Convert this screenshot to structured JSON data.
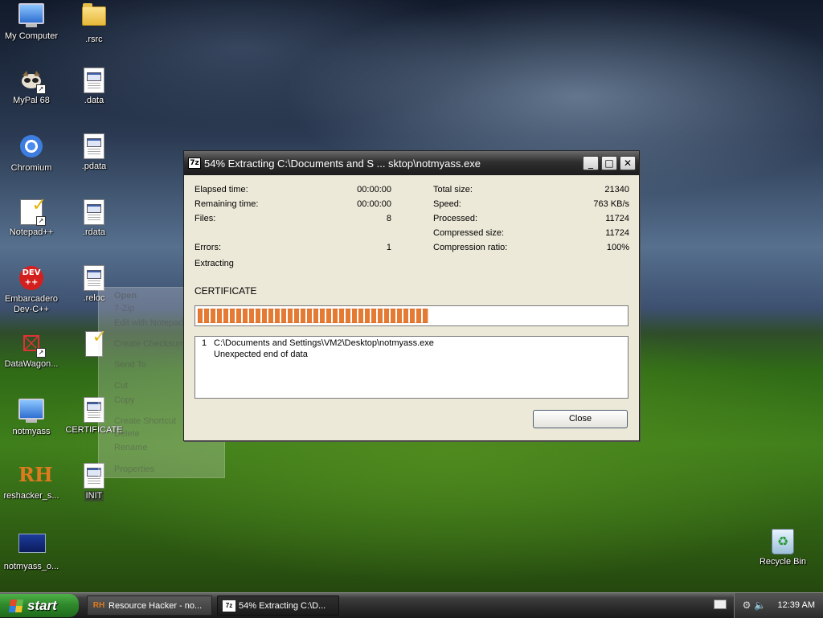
{
  "desktop": {
    "icons": [
      {
        "label": "My Computer"
      },
      {
        "label": ".rsrc"
      },
      {
        "label": "MyPal 68"
      },
      {
        "label": ".data"
      },
      {
        "label": "Chromium"
      },
      {
        "label": ".pdata"
      },
      {
        "label": "Notepad++"
      },
      {
        "label": ".rdata"
      },
      {
        "label": "Embarcadero Dev-C++"
      },
      {
        "label": ".reloc"
      },
      {
        "label": "DataWagon..."
      },
      {
        "label": "notmyass"
      },
      {
        "label": "CERTIFICATE"
      },
      {
        "label": "reshacker_s..."
      },
      {
        "label": "INIT"
      },
      {
        "label": "notmyass_o..."
      },
      {
        "label": "Recycle Bin"
      }
    ],
    "dev_icon_text": "DEV\n++"
  },
  "ghost_menu": {
    "items": [
      "Open",
      "7-Zip",
      "Edit with Notepad++",
      "Create Checksum File",
      "Send To",
      "Cut",
      "Copy",
      "Create Shortcut",
      "Delete",
      "Rename",
      "Properties"
    ]
  },
  "dialog": {
    "title": "54% Extracting C:\\Documents and S ... sktop\\notmyass.exe",
    "app_icon": "7z",
    "left_stats": [
      {
        "label": "Elapsed time:",
        "value": "00:00:00"
      },
      {
        "label": "Remaining time:",
        "value": "00:00:00"
      },
      {
        "label": "Files:",
        "value": "8"
      },
      {
        "label": "Errors:",
        "value": "1"
      }
    ],
    "right_stats": [
      {
        "label": "Total size:",
        "value": "21340"
      },
      {
        "label": "Speed:",
        "value": "763 KB/s"
      },
      {
        "label": "Processed:",
        "value": "11724"
      },
      {
        "label": "Compressed size:",
        "value": "11724"
      },
      {
        "label": "Compression ratio:",
        "value": "100%"
      }
    ],
    "status": "Extracting",
    "current_file": "CERTIFICATE",
    "progress_fraction": 0.54,
    "log": [
      {
        "index": "1",
        "text": "C:\\Documents and Settings\\VM2\\Desktop\\notmyass.exe"
      },
      {
        "index": "",
        "text": "Unexpected end of data"
      }
    ],
    "close_label": "Close"
  },
  "taskbar": {
    "start_label": "start",
    "tasks": [
      {
        "label": "Resource Hacker - no...",
        "icon": "RH"
      },
      {
        "label": "54% Extracting C:\\D...",
        "icon": "7z"
      }
    ],
    "clock": "12:39 AM"
  }
}
